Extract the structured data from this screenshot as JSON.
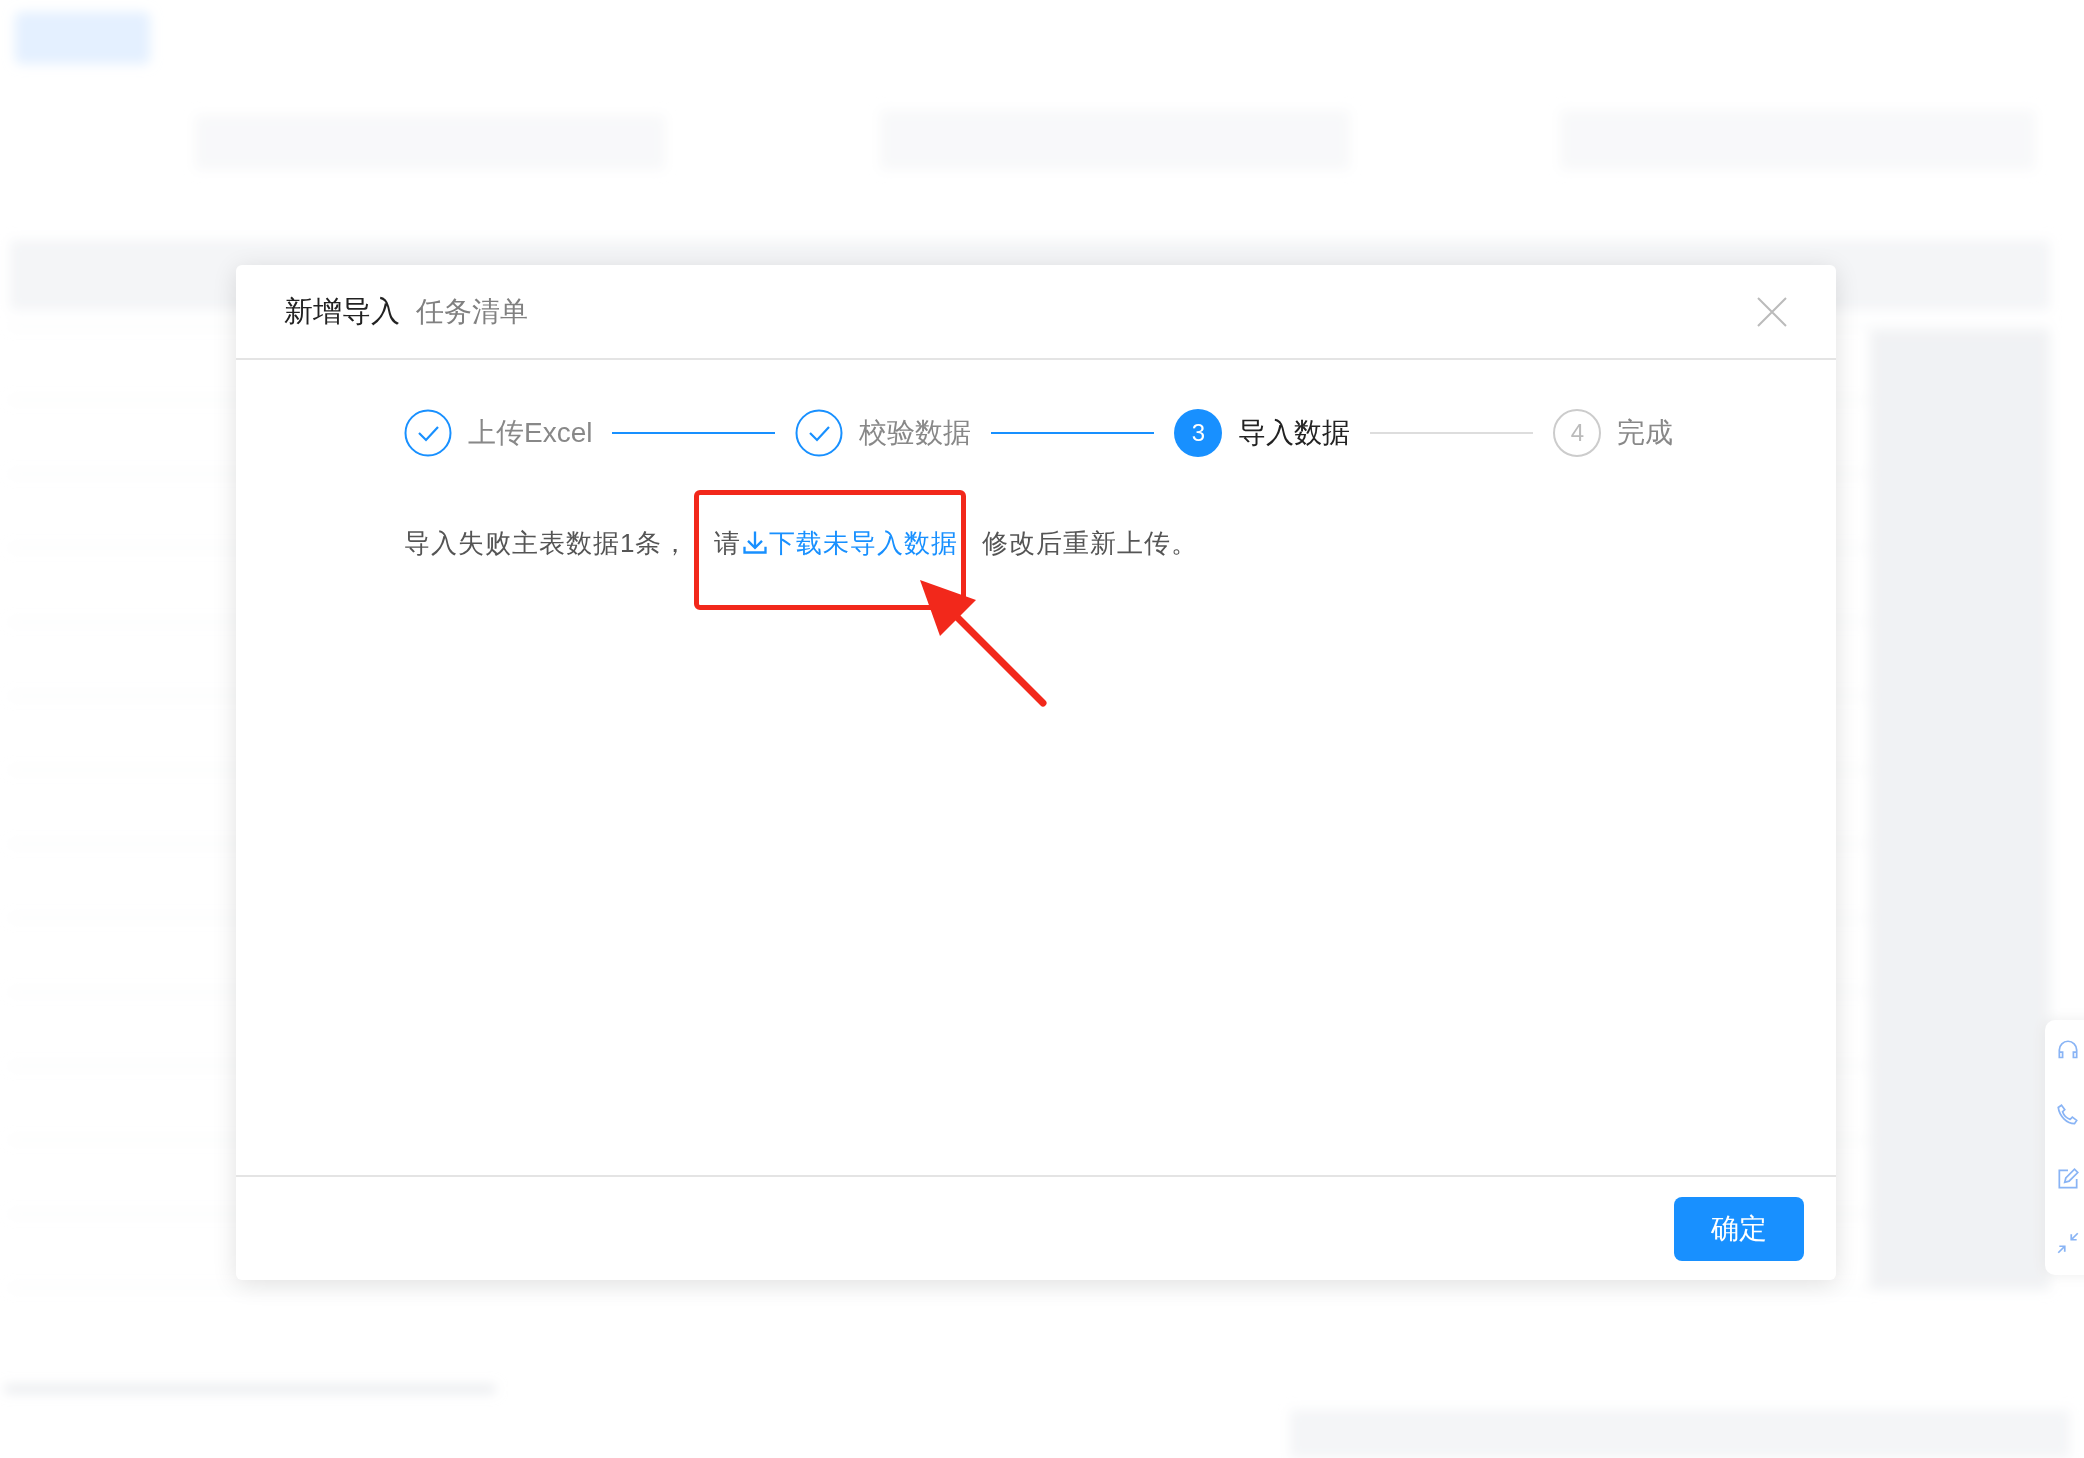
{
  "dialog": {
    "title": "新增导入",
    "subtitle": "任务清单",
    "steps": [
      {
        "label": "上传Excel",
        "done": true,
        "selected": false
      },
      {
        "label": "校验数据",
        "done": true,
        "selected": false
      },
      {
        "label": "导入数据",
        "done": false,
        "selected": true,
        "number": "3"
      },
      {
        "label": "完成",
        "done": false,
        "selected": false,
        "number": "4"
      }
    ],
    "message": {
      "before": "导入失败主表数据1条， 请",
      "link": "下载未导入数据",
      "after": "修改后重新上传。"
    },
    "buttons": [
      "确定"
    ]
  }
}
